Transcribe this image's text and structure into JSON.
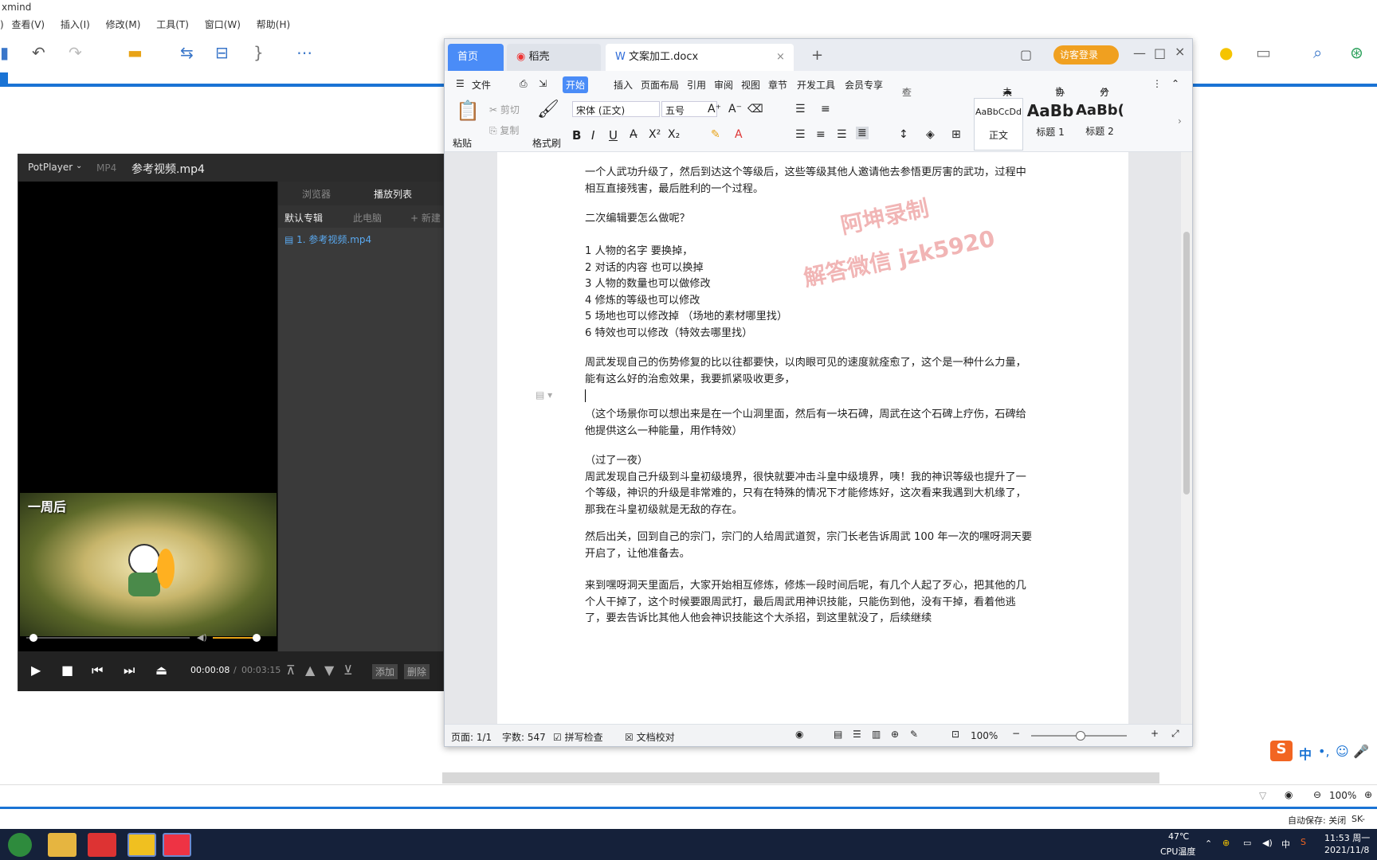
{
  "xmind": {
    "title": "xmind",
    "menu": [
      "查看(V)",
      "插入(I)",
      "修改(M)",
      "工具(T)",
      "窗口(W)",
      "帮助(H)"
    ],
    "status_zoom": "100%",
    "autosave": "自动保存: 关闭",
    "sk": "SK-"
  },
  "potplayer": {
    "app": "PotPlayer",
    "format": "MP4",
    "filename": "参考视频.mp4",
    "tabs": [
      "浏览器",
      "播放列表"
    ],
    "subtabs": [
      "默认专辑",
      "此电脑",
      "+ 新建"
    ],
    "playlist": [
      "1. 参考视频.mp4"
    ],
    "overlay_text": "一周后",
    "time_current": "00:00:08",
    "time_total": "00:03:15",
    "buttons": [
      "添加",
      "删除"
    ],
    "progress": 0.07,
    "volume": 0.8
  },
  "wps": {
    "tabs": {
      "home": "首页",
      "daoke": "稻壳",
      "doc": "文案加工.docx"
    },
    "login": "访客登录",
    "menu": [
      "文件",
      "开始",
      "插入",
      "页面布局",
      "引用",
      "审阅",
      "视图",
      "章节",
      "开发工具",
      "会员专享"
    ],
    "search": "查找命令...",
    "sync": "未同步",
    "collab": "协作",
    "share": "分享",
    "ribbon": {
      "paste": "粘贴",
      "cut": "剪切",
      "copy": "复制",
      "format_painter": "格式刷",
      "font": "宋体 (正文)",
      "size": "五号",
      "style_normal_sample": "AaBbCcDd",
      "style_normal": "正文",
      "style_h1_sample": "AaBb",
      "style_h1": "标题 1",
      "style_h2_sample": "AaBb(",
      "style_h2": "标题 2"
    },
    "paragraphs": [
      "一个人武功升级了，然后到达这个等级后，这些等级其他人邀请他去参悟更厉害的武功，过程中相互直接残害，最后胜利的一个过程。",
      "二次编辑要怎么做呢？",
      "1 人物的名字 要换掉，\n2 对话的内容 也可以换掉\n3 人物的数量也可以做修改\n4 修炼的等级也可以修改\n5 场地也可以修改掉 （场地的素材哪里找）\n6 特效也可以修改（特效去哪里找）",
      "周武发现自己的伤势修复的比以往都要快，以肉眼可见的速度就痊愈了，这个是一种什么力量，能有这么好的治愈效果，我要抓紧吸收更多，",
      "（这个场景你可以想出来是在一个山洞里面，然后有一块石碑，周武在这个石碑上疗伤，石碑给他提供这么一种能量，用作特效）",
      "（过了一夜）\n周武发现自己升级到斗皇初级境界，很快就要冲击斗皇中级境界，咦！我的神识等级也提升了一个等级，神识的升级是非常难的，只有在特殊的情况下才能修炼好，这次看来我遇到大机缘了，那我在斗皇初级就是无敌的存在。",
      "然后出关，回到自己的宗门，宗门的人给周武道贺，宗门长老告诉周武 100 年一次的嘿呀洞天要开启了，让他准备去。",
      "来到嘿呀洞天里面后，大家开始相互修炼，修炼一段时间后呢，有几个人起了歹心，把其他的几个人干掉了，这个时候要跟周武打，最后周武用神识技能，只能伤到他，没有干掉，看着他逃了，要去告诉比其他人他会神识技能这个大杀招，到这里就没了，后续继续"
    ],
    "watermark": [
      "阿坤录制",
      "解答微信 jzk5920"
    ],
    "status": {
      "page": "页面: 1/1",
      "words": "字数: 547",
      "spell": "拼写检查",
      "proof": "文档校对",
      "zoom": "100%"
    }
  },
  "taskbar": {
    "temp": "47℃",
    "temp_label": "CPU温度",
    "time": "11:53 周一",
    "date": "2021/11/8",
    "ime": "中"
  },
  "colors": {
    "accent": "#1a73d4",
    "wps_blue": "#4a8cf7",
    "login": "#f0a020"
  }
}
